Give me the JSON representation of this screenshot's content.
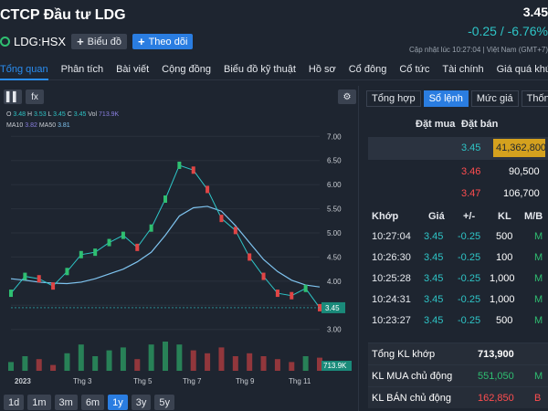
{
  "header": {
    "company_name": "CTCP Đầu tư LDG",
    "price": "3.45",
    "change": "-0.25 / -6.76%",
    "ticker": "LDG:HSX",
    "chart_button": "Biểu đồ",
    "follow_button": "Theo dõi",
    "updated": "Cập nhật lúc  10:27:04 | Việt Nam (GMT+7)"
  },
  "nav": [
    "Tổng quan",
    "Phân tích",
    "Bài viết",
    "Cộng đồng",
    "Biểu đồ kỹ thuật",
    "Hồ sơ",
    "Cổ đông",
    "Cổ tức",
    "Tài chính",
    "Giá quá khứ"
  ],
  "chart_toolbar": {
    "bar_icon_label": "▌▌",
    "fx_label": "fx",
    "settings_icon": "gear-icon"
  },
  "legend": {
    "o_label": "O",
    "o_value": "3.48",
    "h_label": "H",
    "h_value": "3.53",
    "l_label": "L",
    "l_value": "3.45",
    "c_label": "C",
    "c_value": "3.45",
    "vol_label": "Vol",
    "vol_value": "713.9K",
    "ma10_label": "MA10",
    "ma10_value": "3.82",
    "ma50_label": "MA50",
    "ma50_value": "3.81"
  },
  "chart_data": {
    "type": "line",
    "x_ticks": [
      "2023",
      "Thg 3",
      "Thg 5",
      "Thg 7",
      "Thg 9",
      "Thg 11"
    ],
    "y_ticks": [
      "7.00",
      "6.50",
      "6.00",
      "5.50",
      "5.00",
      "4.50",
      "4.00",
      "3.50",
      "3.00"
    ],
    "ylim": [
      2.9,
      7.1
    ],
    "last_price_label": "3.45",
    "volume_label": "713.9K",
    "series": [
      {
        "name": "MA50",
        "color": "#7fc4f0",
        "x": [
          0,
          1,
          2,
          3,
          4,
          5,
          6,
          7,
          8,
          9,
          10,
          11,
          12,
          13,
          14,
          15,
          16,
          17,
          18,
          19,
          20,
          21,
          22
        ],
        "values": [
          4.05,
          4.02,
          3.98,
          3.96,
          3.95,
          3.98,
          4.05,
          4.15,
          4.25,
          4.4,
          4.6,
          4.95,
          5.35,
          5.52,
          5.55,
          5.45,
          5.15,
          4.8,
          4.45,
          4.2,
          4.02,
          3.92,
          3.88
        ]
      },
      {
        "name": "Price",
        "color": "#2ec4c6",
        "x": [
          0,
          1,
          2,
          3,
          4,
          5,
          6,
          7,
          8,
          9,
          10,
          11,
          12,
          13,
          14,
          15,
          16,
          17,
          18,
          19,
          20,
          21,
          22
        ],
        "values": [
          3.75,
          4.1,
          4.05,
          3.9,
          4.2,
          4.55,
          4.6,
          4.8,
          4.95,
          4.7,
          5.1,
          5.7,
          6.4,
          6.3,
          5.9,
          5.3,
          5.05,
          4.5,
          4.1,
          3.75,
          3.7,
          3.85,
          3.45
        ]
      }
    ],
    "volume": [
      0.3,
      0.5,
      0.4,
      0.2,
      0.6,
      0.9,
      0.5,
      0.7,
      0.8,
      0.4,
      0.9,
      1.0,
      0.9,
      0.7,
      0.6,
      0.8,
      0.5,
      0.6,
      0.5,
      0.4,
      0.3,
      0.5,
      0.45
    ]
  },
  "range_buttons": [
    "1d",
    "1m",
    "3m",
    "6m",
    "1y",
    "3y",
    "5y"
  ],
  "active_range": "1y",
  "side_tabs": [
    "Tổng hợp",
    "Sổ lệnh",
    "Mức giá",
    "Thống kê"
  ],
  "active_side_tab": "Sổ lệnh",
  "orderbook": {
    "bid_header": "Đặt mua",
    "ask_header": "Đặt bán",
    "rows": [
      {
        "bid_vol": "",
        "price": "3.45",
        "ask_vol": "41,362,800",
        "price_color": "teal"
      },
      {
        "bid_vol": "",
        "price": "3.46",
        "ask_vol": "90,500",
        "price_color": "red"
      },
      {
        "bid_vol": "",
        "price": "3.47",
        "ask_vol": "106,700",
        "price_color": "red"
      }
    ]
  },
  "trades": {
    "headers": {
      "time": "Khớp",
      "price": "Giá",
      "change": "+/-",
      "vol": "KL",
      "side": "M/B"
    },
    "rows": [
      {
        "time": "10:27:04",
        "price": "3.45",
        "change": "-0.25",
        "vol": "500",
        "side": "M"
      },
      {
        "time": "10:26:30",
        "price": "3.45",
        "change": "-0.25",
        "vol": "100",
        "side": "M"
      },
      {
        "time": "10:25:28",
        "price": "3.45",
        "change": "-0.25",
        "vol": "1,000",
        "side": "M"
      },
      {
        "time": "10:24:31",
        "price": "3.45",
        "change": "-0.25",
        "vol": "1,000",
        "side": "M"
      },
      {
        "time": "10:23:27",
        "price": "3.45",
        "change": "-0.25",
        "vol": "500",
        "side": "M"
      }
    ]
  },
  "summary": {
    "total_label": "Tổng KL khớp",
    "total_value": "713,900",
    "buy_label": "KL MUA chủ động",
    "buy_value": "551,050",
    "sell_label": "KL BÁN chủ động",
    "sell_value": "162,850",
    "sell_side": "B"
  }
}
